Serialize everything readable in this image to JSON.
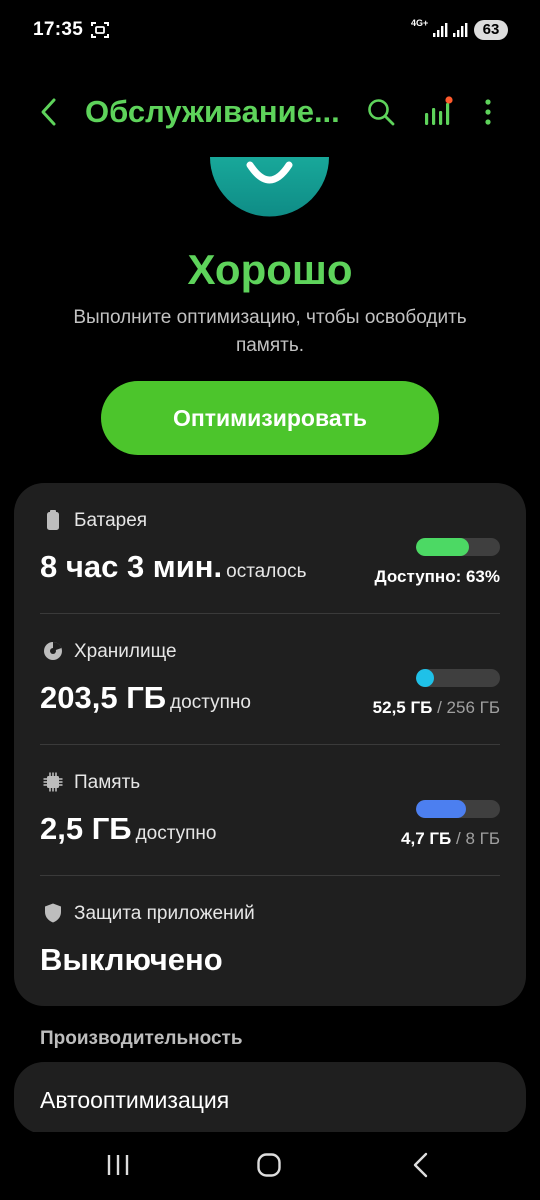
{
  "status_bar": {
    "time": "17:35",
    "network": "4G+",
    "battery": "63"
  },
  "header": {
    "title": "Обслуживание..."
  },
  "summary": {
    "status": "Хорошо",
    "description": "Выполните оптимизацию, чтобы освободить память.",
    "optimize_label": "Оптимизировать"
  },
  "battery": {
    "label": "Батарея",
    "value": "8 час 3 мин.",
    "unit": "осталось",
    "detail": "Доступно: 63%",
    "fill_percent": 63,
    "color": "#4cd964"
  },
  "storage": {
    "label": "Хранилище",
    "value": "203,5 ГБ",
    "unit": "доступно",
    "used": "52,5 ГБ",
    "separator": "/",
    "total": "256 ГБ",
    "fill_percent": 20.5,
    "color": "#1fc1e8"
  },
  "memory": {
    "label": "Память",
    "value": "2,5 ГБ",
    "unit": "доступно",
    "used": "4,7 ГБ",
    "separator": "/",
    "total": "8 ГБ",
    "fill_percent": 59,
    "color": "#4c7ff0"
  },
  "app_protection": {
    "label": "Защита приложений",
    "value": "Выключено"
  },
  "performance": {
    "section_title": "Производительность",
    "auto_label": "Автооптимизация"
  },
  "colors": {
    "accent": "#5ed35b",
    "button": "#4cc52c",
    "card": "#1f1f1f"
  }
}
